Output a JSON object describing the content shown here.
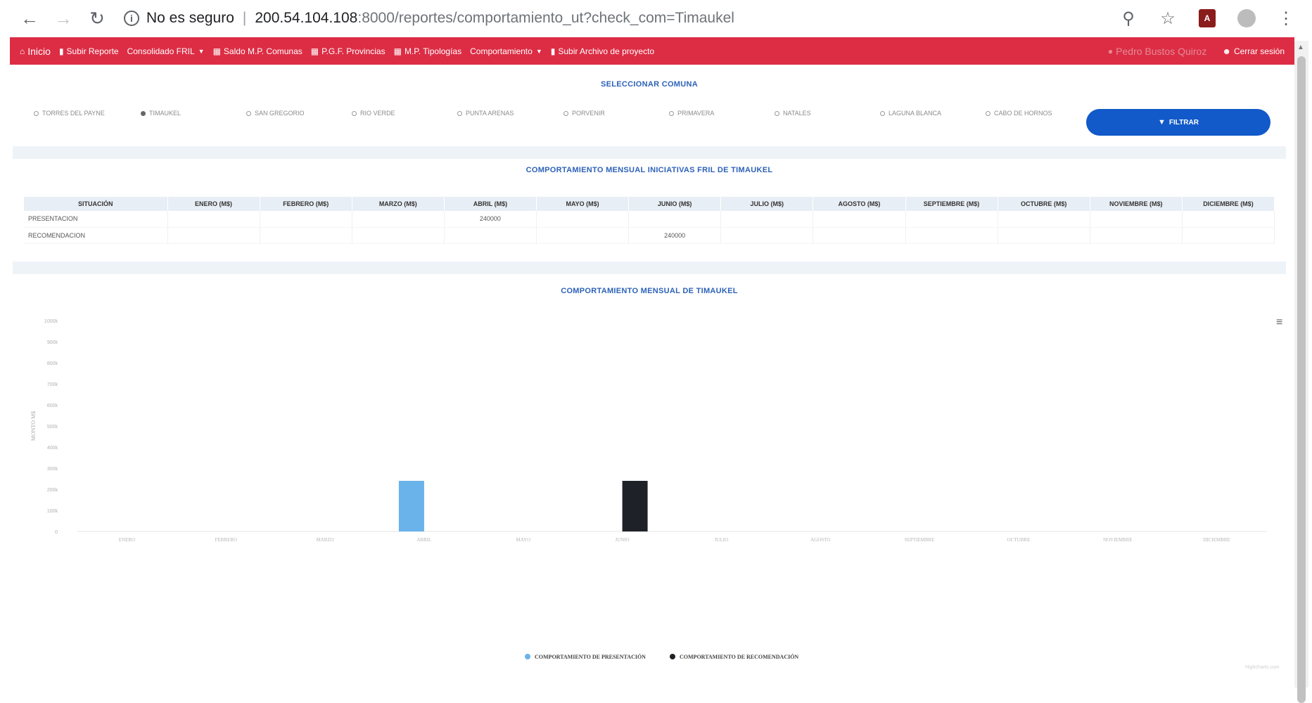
{
  "browser": {
    "security": "No es seguro",
    "url_host": "200.54.104.108",
    "url_path": ":8000/reportes/comportamiento_ut?check_com=Timaukel"
  },
  "nav": {
    "inicio": "Inicio",
    "subir_reporte": "Subir Reporte",
    "consolidado": "Consolidado FRIL",
    "saldo": "Saldo M.P. Comunas",
    "pgf": "P.G.F. Provincias",
    "tipologias": "M.P. Tipologías",
    "comportamiento": "Comportamiento",
    "subir_archivo": "Subir Archivo de proyecto",
    "user": "Pedro Bustos Quiroz",
    "logout": "Cerrar sesión"
  },
  "communes": {
    "title": "SELECCIONAR COMUNA",
    "options": [
      "TORRES DEL PAYNE",
      "TIMAUKEL",
      "SAN GREGORIO",
      "RIO VERDE",
      "PUNTA ARENAS",
      "PORVENIR",
      "PRIMAVERA",
      "NATALES",
      "LAGUNA BLANCA",
      "CABO DE HORNOS"
    ],
    "selected": "TIMAUKEL",
    "filter_label": "FILTRAR"
  },
  "table": {
    "title": "COMPORTAMIENTO MENSUAL INICIATIVAS FRIL DE TIMAUKEL",
    "headers": [
      "SITUACIÓN",
      "ENERO (M$)",
      "FEBRERO (M$)",
      "MARZO (M$)",
      "ABRIL (M$)",
      "MAYO (M$)",
      "JUNIO (M$)",
      "JULIO (M$)",
      "AGOSTO (M$)",
      "SEPTIEMBRE (M$)",
      "OCTUBRE (M$)",
      "NOVIEMBRE (M$)",
      "DICIEMBRE (M$)"
    ],
    "rows": [
      [
        "PRESENTACION",
        "",
        "",
        "",
        "240000",
        "",
        "",
        "",
        "",
        "",
        "",
        "",
        ""
      ],
      [
        "RECOMENDACION",
        "",
        "",
        "",
        "",
        "",
        "240000",
        "",
        "",
        "",
        "",
        "",
        ""
      ]
    ]
  },
  "chart_data": {
    "type": "bar",
    "title": "COMPORTAMIENTO MENSUAL DE TIMAUKEL",
    "ylabel": "MONTO M$",
    "xlabel": "",
    "categories": [
      "ENERO",
      "FEBRERO",
      "MARZO",
      "ABRIL",
      "MAYO",
      "JUNIO",
      "JULIO",
      "AGOSTO",
      "SEPTIEMBRE",
      "OCTUBRE",
      "NOVIEMBRE",
      "DICIEMBRE"
    ],
    "series": [
      {
        "name": "COMPORTAMIENTO DE PRESENTACIÓN",
        "color": "#6ab2ea",
        "values": [
          0,
          0,
          0,
          240000,
          0,
          0,
          0,
          0,
          0,
          0,
          0,
          0
        ]
      },
      {
        "name": "COMPORTAMIENTO DE RECOMENDACIÓN",
        "color": "#1e2127",
        "values": [
          0,
          0,
          0,
          0,
          0,
          240000,
          0,
          0,
          0,
          0,
          0,
          0
        ]
      }
    ],
    "ylim": [
      0,
      1000000
    ],
    "yticks": [
      "0",
      "100k",
      "200k",
      "300k",
      "400k",
      "500k",
      "600k",
      "700k",
      "800k",
      "900k",
      "1000k"
    ],
    "legend": "bottom",
    "grid": false
  }
}
